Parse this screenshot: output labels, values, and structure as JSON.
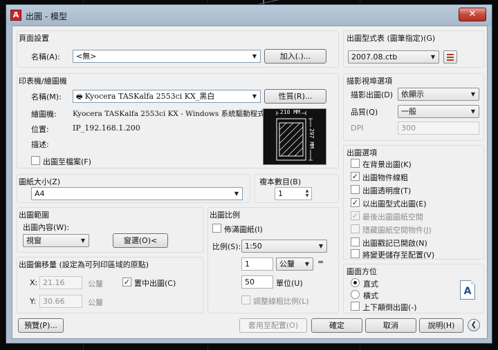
{
  "window": {
    "title": "出圖 - 模型",
    "app_icon": "A",
    "close": "✕"
  },
  "page_setup": {
    "group": "頁面設置",
    "name_label": "名稱(A):",
    "name_value": "<無>",
    "add_button": "加入(.)..."
  },
  "plotter": {
    "group": "印表機/繪圖機",
    "name_label": "名稱(M):",
    "name_value": "Kyocera TASKalfa 2553ci KX_黑白",
    "properties_button": "性質(R)...",
    "plotter_label": "繪圖機:",
    "plotter_value": "Kyocera TASKalfa 2553ci KX - Windows 系統驅動程式...",
    "location_label": "位置:",
    "location_value": "IP_192.168.1.200",
    "description_label": "描述:",
    "plot_to_file": "出圖至檔案(F)",
    "preview_width": "210 MM",
    "preview_height": "297 MM"
  },
  "paper_size": {
    "group": "圖紙大小(Z)",
    "value": "A4"
  },
  "copies": {
    "group": "複本數目(B)",
    "value": "1"
  },
  "plot_area": {
    "group": "出圖範圍",
    "what_label": "出圖內容(W):",
    "what_value": "視窗",
    "window_button": "窗選(O)<"
  },
  "plot_offset": {
    "group": "出圖偏移量 (設定為可列印區域的原點)",
    "x_label": "X:",
    "x_value": "21.16",
    "x_unit": "公釐",
    "y_label": "Y:",
    "y_value": "30.66",
    "y_unit": "公釐",
    "center": "置中出圖(C)"
  },
  "plot_scale": {
    "group": "出圖比例",
    "fit": "佈滿圖紙(I)",
    "scale_label": "比例(S):",
    "scale_value": "1:50",
    "num1": "1",
    "unit_value": "公釐",
    "equals": "=",
    "num2": "50",
    "units_label": "單位(U)",
    "scale_lineweights": "調整線粗比例(L)"
  },
  "plot_style": {
    "group": "出圖型式表 (圖筆指定)(G)",
    "value": "2007.08.ctb"
  },
  "shaded_viewport": {
    "group": "描影視埠選項",
    "shade_label": "描影出圖(D)",
    "shade_value": "依顯示",
    "quality_label": "品質(Q)",
    "quality_value": "一般",
    "dpi_label": "DPI",
    "dpi_value": "300"
  },
  "plot_options": {
    "group": "出圖選項",
    "items": [
      {
        "label": "在背景出圖(K)",
        "mark": ""
      },
      {
        "label": "出圖物件線粗",
        "mark": "✓"
      },
      {
        "label": "出圖透明度(T)",
        "mark": ""
      },
      {
        "label": "以出圖型式出圖(E)",
        "mark": "✓"
      },
      {
        "label": "最後出圖圖紙空間",
        "mark": "✓"
      },
      {
        "label": "隱藏圖紙空間物件(J)",
        "mark": ""
      },
      {
        "label": "出圖戳記已開啟(N)",
        "mark": ""
      },
      {
        "label": "將變更儲存至配置(V)",
        "mark": ""
      }
    ]
  },
  "orientation": {
    "group": "圖面方位",
    "portrait": "直式",
    "landscape": "橫式",
    "upside_down": "上下顛倒出圖(-)",
    "icon_letter": "A"
  },
  "footer": {
    "preview": "預覽(P)...",
    "apply": "套用至配置(O)",
    "ok": "確定",
    "cancel": "取消",
    "help": "說明(H)"
  },
  "colors": {
    "window_frame": "#aebfd0",
    "dialog_bg": "#f0f0f0",
    "close_button": "#c7493a",
    "app_icon": "#c8262a"
  }
}
